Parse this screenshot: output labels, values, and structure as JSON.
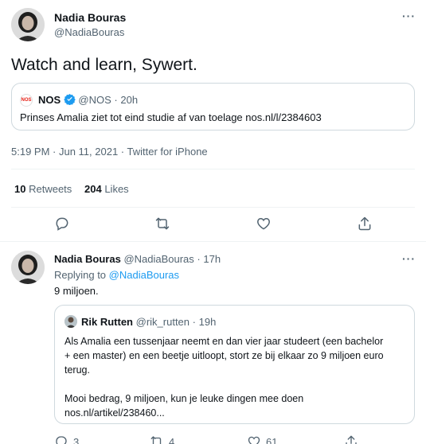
{
  "main_tweet": {
    "author_name": "Nadia Bouras",
    "handle": "@NadiaBouras",
    "text": "Watch and learn, Sywert.",
    "quote": {
      "source_logo_text": "NOS",
      "source_name": "NOS",
      "source_handle": "@NOS",
      "separator": "·",
      "time": "20h",
      "text": "Prinses Amalia ziet tot eind studie af van toelage nos.nl/l/2384603"
    },
    "meta": "5:19 PM · Jun 11, 2021 · Twitter for iPhone",
    "stats": {
      "retweets_count": "10",
      "retweets_label": "Retweets",
      "likes_count": "204",
      "likes_label": "Likes"
    }
  },
  "reply_tweet": {
    "author_name": "Nadia Bouras",
    "handle": "@NadiaBouras",
    "separator": "·",
    "time": "17h",
    "replying_label": "Replying to",
    "replying_handle": "@NadiaBouras",
    "text": "9 miljoen.",
    "quote": {
      "author_name": "Rik Rutten",
      "handle": "@rik_rutten",
      "separator": "·",
      "time": "19h",
      "line1": "Als Amalia een tussenjaar neemt en dan vier jaar studeert (een bachelor",
      "line2": "+ een master) en een beetje uitloopt, stort ze bij elkaar zo 9 miljoen euro",
      "line3": "terug.",
      "line4": "Mooi bedrag, 9 miljoen, kun je leuke dingen mee doen",
      "line5": "nos.nl/artikel/238460..."
    },
    "actions": {
      "reply_count": "3",
      "retweet_count": "4",
      "like_count": "61"
    }
  },
  "icons": {
    "more": "more-dots-icon",
    "reply": "reply-icon",
    "retweet": "retweet-icon",
    "like": "heart-icon",
    "share": "share-icon",
    "verified": "verified-badge-icon"
  },
  "colors": {
    "text": "#0f1419",
    "muted": "#536471",
    "link": "#1d9bf0",
    "border": "#cfd9de",
    "nos_red": "#e61e14"
  }
}
